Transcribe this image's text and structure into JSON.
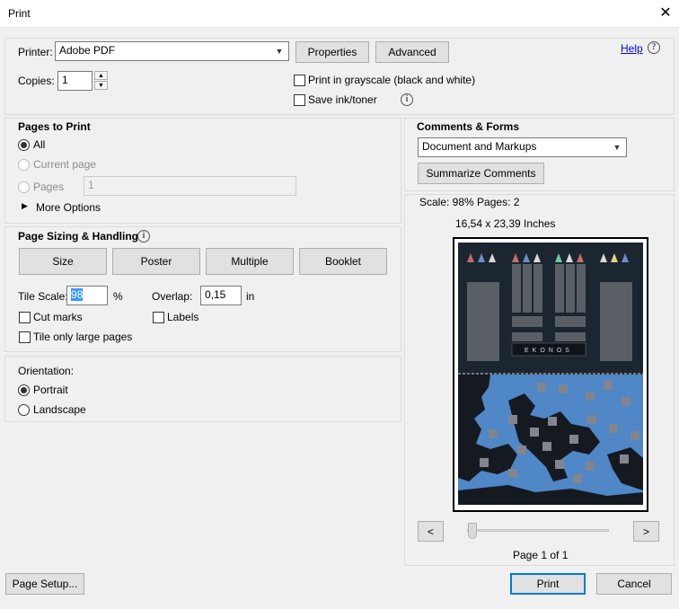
{
  "window": {
    "title": "Print",
    "close_glyph": "✕"
  },
  "printer": {
    "label": "Printer:",
    "selected": "Adobe PDF",
    "properties_label": "Properties",
    "advanced_label": "Advanced",
    "help_label": "Help",
    "copies_label": "Copies:",
    "copies_value": "1",
    "grayscale_label": "Print in grayscale (black and white)",
    "grayscale_checked": false,
    "save_ink_label": "Save ink/toner",
    "save_ink_checked": false
  },
  "pages_to_print": {
    "heading": "Pages to Print",
    "all_label": "All",
    "current_page_label": "Current page",
    "pages_label": "Pages",
    "pages_value": "1",
    "more_options_label": "More Options",
    "selected": "All"
  },
  "sizing": {
    "heading": "Page Sizing & Handling",
    "tabs": [
      "Size",
      "Poster",
      "Multiple",
      "Booklet"
    ],
    "tile_scale_label": "Tile Scale:",
    "tile_scale_value": "98",
    "tile_scale_unit": "%",
    "overlap_label": "Overlap:",
    "overlap_value": "0,15",
    "overlap_unit": "in",
    "cut_marks_label": "Cut marks",
    "labels_label": "Labels",
    "tile_large_label": "Tile only large pages"
  },
  "orientation": {
    "heading": "Orientation:",
    "portrait_label": "Portrait",
    "landscape_label": "Landscape",
    "selected": "Portrait"
  },
  "comments_forms": {
    "heading": "Comments & Forms",
    "selected": "Document and Markups",
    "summarize_label": "Summarize Comments"
  },
  "preview": {
    "scale_text": "Scale:  98% Pages: 2",
    "dimensions_text": "16,54 x 23,39 Inches",
    "map_title": "EKONOS",
    "prev_label": "<",
    "next_label": ">",
    "page_indicator": "Page 1 of 1",
    "page_position": 0
  },
  "footer": {
    "page_setup_label": "Page Setup...",
    "print_label": "Print",
    "cancel_label": "Cancel"
  },
  "colors": {
    "accent": "#0078d7",
    "board_dark": "#1c2631",
    "sea_blue": "#4f87c7",
    "land_dark": "#141a20"
  }
}
